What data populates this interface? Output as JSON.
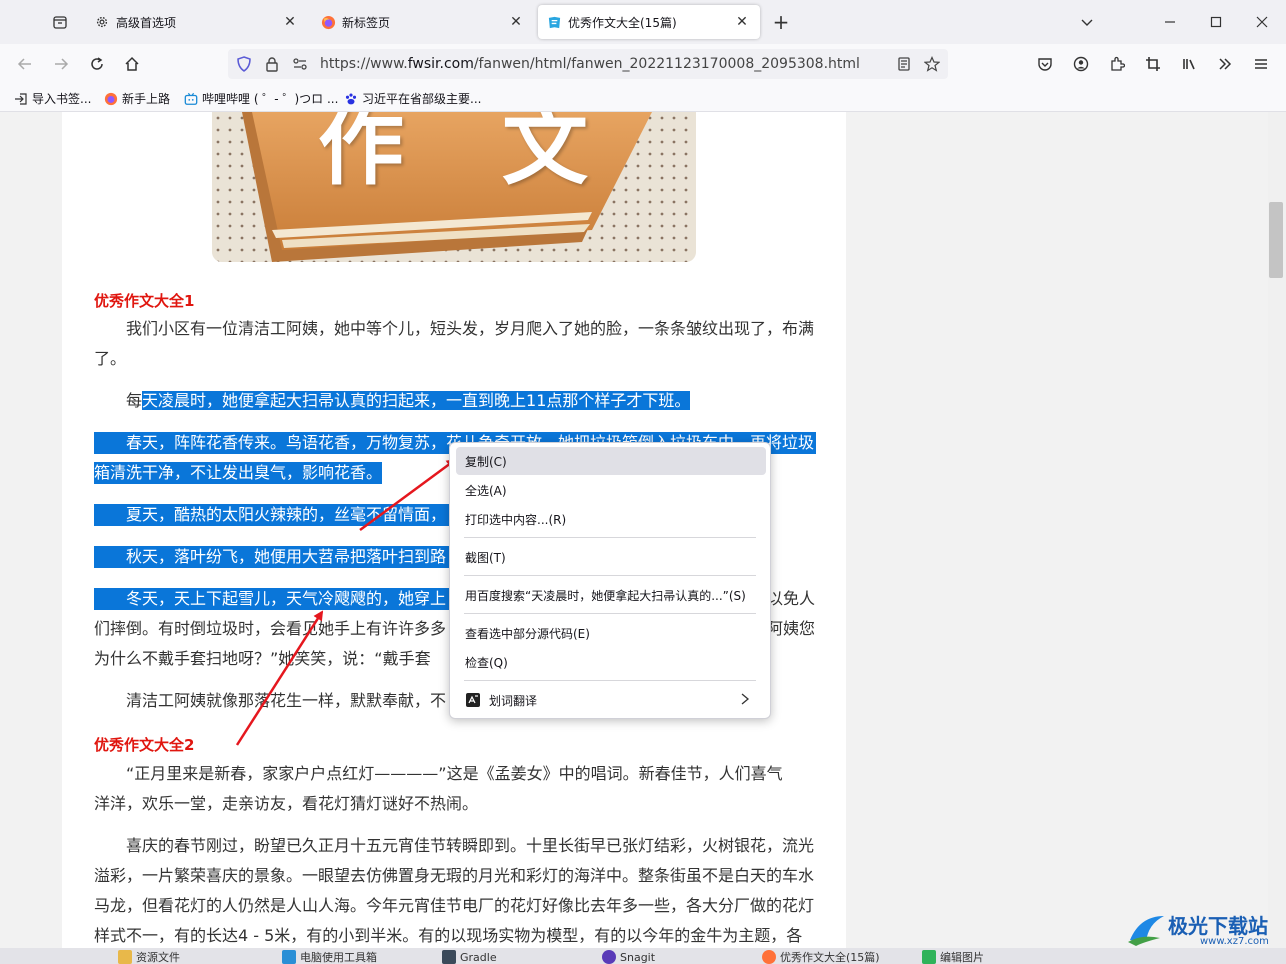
{
  "tabs": [
    {
      "title": "高级首选项",
      "icon": "gear-icon",
      "active": false
    },
    {
      "title": "新标签页",
      "icon": "firefox-icon",
      "active": false
    },
    {
      "title": "优秀作文大全(15篇)",
      "icon": "site-icon",
      "active": true
    }
  ],
  "url": {
    "prefix": "https://www.",
    "domain": "fwsir.com",
    "path": "/fanwen/html/fanwen_20221123170008_2095308.html"
  },
  "bookmarks": [
    {
      "label": "导入书签...",
      "icon": "import-icon"
    },
    {
      "label": "新手上路",
      "icon": "firefox-icon"
    },
    {
      "label": "哔哩哔哩 ( ゜- ゜)つロ ...",
      "icon": "bilibili-icon"
    },
    {
      "label": "习近平在省部级主要...",
      "icon": "baidu-paw-icon"
    }
  ],
  "hero_text": "作 文",
  "article": {
    "section1_title": "优秀作文大全1",
    "p1_l1": "我们小区有一位清洁工阿姨，她中等个儿，短头发，岁月爬入了她的脸，一条条皱纹出现了，布满",
    "p1_l2": "了。",
    "p2_pre": "每",
    "p2_sel": "天凌晨时，她便拿起大扫帚认真的扫起来，一直到晚上11点那个样子才下班。",
    "p3_l1": "春天，阵阵花香传来。鸟语花香，万物复苏，",
    "p3_l1_tail": "花儿争奇开放，她把垃圾箱倒入垃圾车中，再将垃圾",
    "p3_l2": "箱清洗干净，不让发出臭气，影响花香。",
    "p4": "夏天，酷热的太阳火辣辣的，丝毫不留情面，",
    "p5": "秋天，落叶纷飞，她便用大苕帚把落叶扫到路",
    "p6_l1": "冬天，天上下起雪儿，天气冷飕飕的，她穿上",
    "p6_l1_tail": "以免人",
    "p6_l2": "们摔倒。有时倒垃圾时，会看见她手上有许许多多",
    "p6_l2_tail": "阿姨您",
    "p6_l3": "为什么不戴手套扫地呀？”她笑笑，说：“戴手套",
    "p7": "清洁工阿姨就像那落花生一样，默默奉献，不",
    "section2_title": "优秀作文大全2",
    "q1_l1": "“正月里来是新春，家家户户点红灯————”这是《孟姜女》中的唱词。新春佳节，人们喜气",
    "q1_l2": "洋洋，欢乐一堂，走亲访友，看花灯猜灯谜好不热闹。",
    "q2_l1": "喜庆的春节刚过，盼望已久正月十五元宵佳节转瞬即到。十里长街早已张灯结彩，火树银花，流光",
    "q2_l2": "溢彩，一片繁荣喜庆的景象。一眼望去仿佛置身无瑕的月光和彩灯的海洋中。整条街虽不是白天的车水",
    "q2_l3": "马龙，但看花灯的人仍然是人山人海。今年元宵佳节电厂的花灯好像比去年多一些，各大分厂做的花灯",
    "q2_l4": "样式不一，有的长达4 - 5米，有的小到半米。有的以现场实物为模型，有的以今年的金牛为主题，各"
  },
  "context_menu": [
    {
      "label": "复制(C)"
    },
    {
      "label": "全选(A)"
    },
    {
      "label": "打印选中内容...(R)"
    },
    {
      "label": "截图(T)"
    },
    {
      "label": "用百度搜索“天凌晨时，她便拿起大扫帚认真的...”(S)"
    },
    {
      "label": "查看选中部分源代码(E)"
    },
    {
      "label": "检查(Q)"
    },
    {
      "label": "划词翻译"
    }
  ],
  "taskbar": [
    {
      "label": "资源文件"
    },
    {
      "label": "电脑使用工具箱"
    },
    {
      "label": "Gradle"
    },
    {
      "label": "Snagit"
    },
    {
      "label": "优秀作文大全(15篇)"
    },
    {
      "label": "编辑图片"
    }
  ],
  "watermark": {
    "title": "极光下载站",
    "url": "www.xz7.com"
  },
  "colors": {
    "selection": "#0a76d9",
    "heading": "#e0160f",
    "arrow": "#e5171e"
  }
}
